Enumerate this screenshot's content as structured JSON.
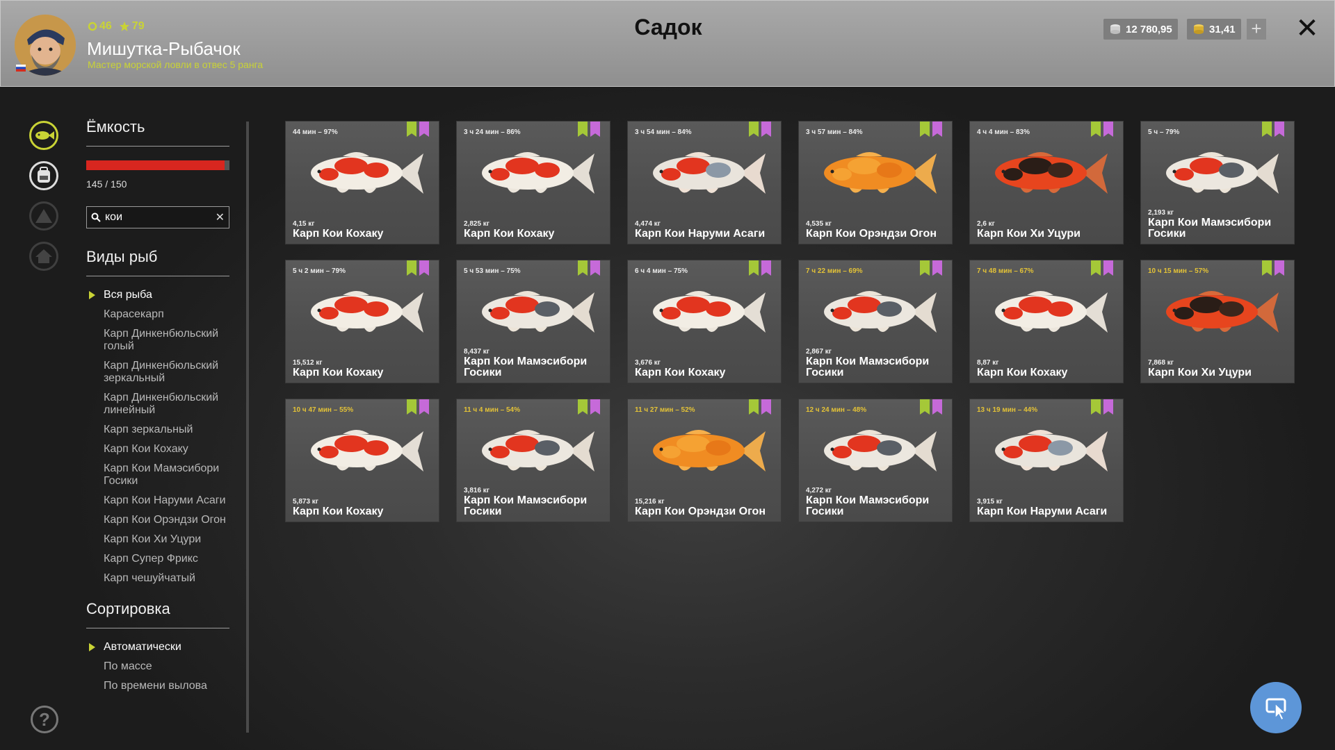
{
  "header": {
    "title": "Садок",
    "username": "Мишутка-Рыбачок",
    "rank": "Мастер морской ловли в отвес 5 ранга",
    "level": "46",
    "stars": "79",
    "silver": "12 780,95",
    "gold": "31,41"
  },
  "capacity": {
    "title": "Ёмкость",
    "text": "145 / 150",
    "fill_fraction": 0.967
  },
  "search": {
    "value": "кои"
  },
  "fish_types": {
    "title": "Виды рыб",
    "items": [
      "Вся рыба",
      "Карасекарп",
      "Карп Динкенбюльский голый",
      "Карп Динкенбюльский зеркальный",
      "Карп Динкенбюльский линейный",
      "Карп зеркальный",
      "Карп Кои Кохаку",
      "Карп Кои Мамэсибори Госики",
      "Карп Кои Наруми Асаги",
      "Карп Кои Орэндзи Огон",
      "Карп Кои Хи Уцури",
      "Карп Супер Фрикс",
      "Карп чешуйчатый"
    ]
  },
  "sorting": {
    "title": "Сортировка",
    "items": [
      "Автоматически",
      "По массе",
      "По времени вылова"
    ]
  },
  "fish": [
    {
      "time": "44 мин – 97%",
      "weight": "4,15 кг",
      "name": "Карп Кои Кохаку",
      "variety": "kohaku",
      "warn": false
    },
    {
      "time": "3 ч 24 мин – 86%",
      "weight": "2,825 кг",
      "name": "Карп Кои Кохаку",
      "variety": "kohaku",
      "warn": false
    },
    {
      "time": "3 ч 54 мин – 84%",
      "weight": "4,474 кг",
      "name": "Карп Кои Наруми Асаги",
      "variety": "asagi",
      "warn": false
    },
    {
      "time": "3 ч 57 мин – 84%",
      "weight": "4,535 кг",
      "name": "Карп Кои Орэндзи Огон",
      "variety": "ogon",
      "warn": false
    },
    {
      "time": "4 ч 4 мин – 83%",
      "weight": "2,6 кг",
      "name": "Карп Кои Хи Уцури",
      "variety": "utsuri",
      "warn": false
    },
    {
      "time": "5 ч – 79%",
      "weight": "2,193 кг",
      "name": "Карп Кои Мамэсибори Госики",
      "variety": "goshiki",
      "warn": false
    },
    {
      "time": "5 ч 2 мин – 79%",
      "weight": "15,512 кг",
      "name": "Карп Кои Кохаку",
      "variety": "kohaku",
      "warn": false
    },
    {
      "time": "5 ч 53 мин – 75%",
      "weight": "8,437 кг",
      "name": "Карп Кои Мамэсибори Госики",
      "variety": "goshiki",
      "warn": false
    },
    {
      "time": "6 ч 4 мин – 75%",
      "weight": "3,676 кг",
      "name": "Карп Кои Кохаку",
      "variety": "kohaku",
      "warn": false
    },
    {
      "time": "7 ч 22 мин – 69%",
      "weight": "2,867 кг",
      "name": "Карп Кои Мамэсибори Госики",
      "variety": "goshiki",
      "warn": true
    },
    {
      "time": "7 ч 48 мин – 67%",
      "weight": "8,87 кг",
      "name": "Карп Кои Кохаку",
      "variety": "kohaku",
      "warn": true
    },
    {
      "time": "10 ч 15 мин – 57%",
      "weight": "7,868 кг",
      "name": "Карп Кои Хи Уцури",
      "variety": "utsuri",
      "warn": true
    },
    {
      "time": "10 ч 47 мин – 55%",
      "weight": "5,873 кг",
      "name": "Карп Кои Кохаку",
      "variety": "kohaku",
      "warn": true
    },
    {
      "time": "11 ч 4 мин – 54%",
      "weight": "3,816 кг",
      "name": "Карп Кои Мамэсибори Госики",
      "variety": "goshiki",
      "warn": true
    },
    {
      "time": "11 ч 27 мин – 52%",
      "weight": "15,216 кг",
      "name": "Карп Кои Орэндзи Огон",
      "variety": "ogon",
      "warn": true
    },
    {
      "time": "12 ч 24 мин – 48%",
      "weight": "4,272 кг",
      "name": "Карп Кои Мамэсибори Госики",
      "variety": "goshiki",
      "warn": true
    },
    {
      "time": "13 ч 19 мин – 44%",
      "weight": "3,915 кг",
      "name": "Карп Кои Наруми Асаги",
      "variety": "asagi",
      "warn": true
    }
  ],
  "icons": {
    "keepnet_tab": "fish-icon",
    "boat_tab": "backpack-icon",
    "camp_tab": "tent-icon",
    "home_tab": "home-icon",
    "help": "question-icon",
    "cursor": "cursor-icon"
  },
  "colors": {
    "accent": "#c9d335",
    "capacity_bar": "#d8261f",
    "warn_time": "#e3c237",
    "bookmark_green": "#a5c838",
    "bookmark_purple": "#c66ad9",
    "cursor_button": "#5d96d8"
  }
}
